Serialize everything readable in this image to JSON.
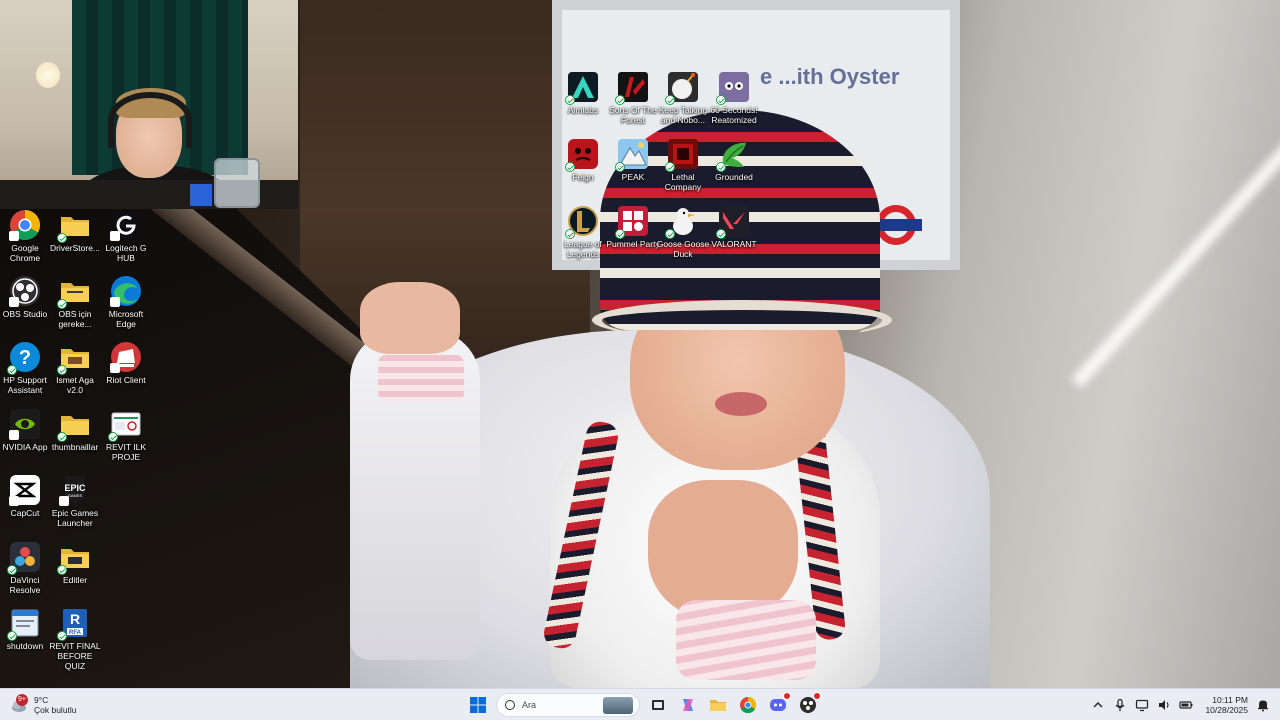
{
  "desktop": {
    "icons": [
      {
        "label": "Google Chrome",
        "icon": "chrome-icon"
      },
      {
        "label": "DriverStore...",
        "icon": "folder-icon"
      },
      {
        "label": "Logitech G HUB",
        "icon": "logitech-icon"
      },
      {
        "label": "OBS Studio",
        "icon": "obs-icon"
      },
      {
        "label": "OBS için gereke...",
        "icon": "folder-icon"
      },
      {
        "label": "Microsoft Edge",
        "icon": "edge-icon"
      },
      {
        "label": "HP Support Assistant",
        "icon": "hp-support-icon"
      },
      {
        "label": "Ismet Aga v2.0",
        "icon": "folder-icon"
      },
      {
        "label": "Riot Client",
        "icon": "riot-icon"
      },
      {
        "label": "NVIDIA App",
        "icon": "nvidia-icon"
      },
      {
        "label": "thumbnaillar",
        "icon": "folder-icon"
      },
      {
        "label": "REVIT ILK PROJE",
        "icon": "revit-project-icon"
      },
      {
        "label": "CapCut",
        "icon": "capcut-icon"
      },
      {
        "label": "Epic Games Launcher",
        "icon": "epic-games-icon"
      },
      {
        "label": "DaVinci Resolve",
        "icon": "davinci-icon"
      },
      {
        "label": "Editler",
        "icon": "folder-icon"
      },
      {
        "label": "shutdown",
        "icon": "shutdown-file-icon"
      },
      {
        "label": "REVIT FINAL BEFORE QUIZ",
        "icon": "rfa-file-icon"
      },
      {
        "label": "Aimlabs",
        "icon": "aimlabs-icon"
      },
      {
        "label": "Sons Of The Forest",
        "icon": "sons-of-the-forest-icon"
      },
      {
        "label": "Keep Talking and Nobo...",
        "icon": "keep-talking-icon"
      },
      {
        "label": "60 Seconds! Reatomized",
        "icon": "60-seconds-icon"
      },
      {
        "label": "Feign",
        "icon": "feign-icon"
      },
      {
        "label": "PEAK",
        "icon": "peak-icon"
      },
      {
        "label": "Lethal Company",
        "icon": "lethal-company-icon"
      },
      {
        "label": "Grounded",
        "icon": "grounded-icon"
      },
      {
        "label": "League of Legends",
        "icon": "league-of-legends-icon"
      },
      {
        "label": "Pummel Party",
        "icon": "pummel-party-icon"
      },
      {
        "label": "Goose Goose Duck",
        "icon": "goose-goose-duck-icon"
      },
      {
        "label": "VALORANT",
        "icon": "valorant-icon"
      }
    ]
  },
  "wallpaper": {
    "sign_text": "e ...ith Oyster"
  },
  "taskbar": {
    "weather": {
      "temp": "9°C",
      "condition": "Çok bulutlu",
      "badge": "9+"
    },
    "search": {
      "placeholder": "Ara"
    },
    "clock": {
      "time": "10:11 PM",
      "date": "10/28/2025"
    }
  }
}
